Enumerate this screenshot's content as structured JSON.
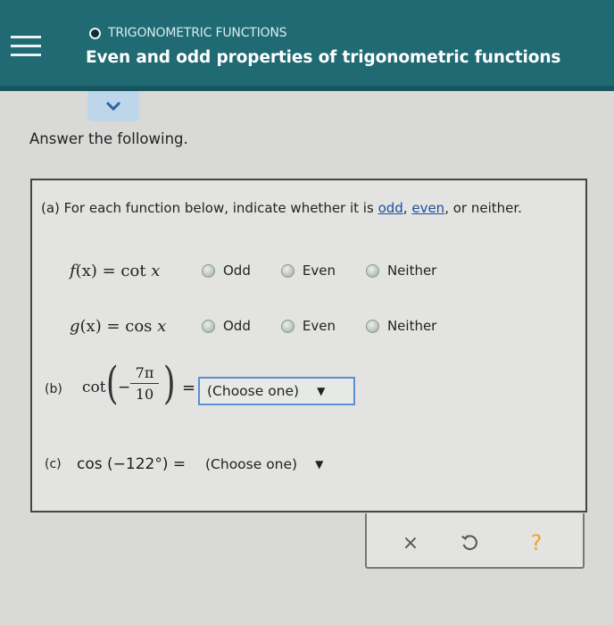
{
  "header": {
    "menu_icon": "hamburger-menu-icon",
    "topic_icon": "circle-dot-icon",
    "topic": "TRIGONOMETRIC FUNCTIONS",
    "title": "Even and odd properties of trigonometric functions",
    "expand_icon": "chevron-down-icon"
  },
  "prompt": "Answer the following.",
  "part_a": {
    "instruction_prefix": "(a) For each function below, indicate whether it is ",
    "odd_link": "odd",
    "sep1": ", ",
    "even_link": "even",
    "instruction_suffix": ", or neither.",
    "rows": [
      {
        "fx": "f",
        "arg": "(x)",
        "rhs": " = cot",
        "var": "x"
      },
      {
        "fx": "g",
        "arg": "(x)",
        "rhs": " = cos",
        "var": "x"
      }
    ],
    "options": [
      "Odd",
      "Even",
      "Neither"
    ]
  },
  "part_b": {
    "label": "(b)",
    "func": "cot",
    "minus": "−",
    "numerator": "7π",
    "denominator": "10",
    "equals": "=",
    "select_value": "(Choose one)",
    "arrow": "▼"
  },
  "part_c": {
    "label": "(c)",
    "expression": "cos (−122°) =",
    "select_value": "(Choose one)",
    "arrow": "▼"
  },
  "actions": {
    "clear": "×",
    "undo_icon": "undo-icon",
    "help": "?"
  },
  "colors": {
    "header": "#1f6a73",
    "link": "#1e4fa3",
    "help": "#f1a12b"
  }
}
